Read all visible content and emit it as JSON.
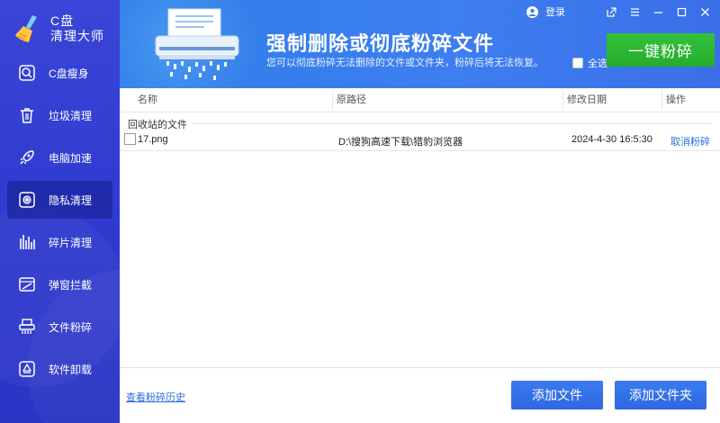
{
  "app": {
    "logo_line1": "C盘",
    "logo_line2": "清理大师"
  },
  "sidebar": {
    "items": [
      {
        "label": "C盘瘦身",
        "icon": "magnify-icon"
      },
      {
        "label": "垃圾清理",
        "icon": "trash-icon"
      },
      {
        "label": "电脑加速",
        "icon": "rocket-icon"
      },
      {
        "label": "隐私清理",
        "icon": "privacy-icon",
        "active": true
      },
      {
        "label": "碎片清理",
        "icon": "fragment-icon"
      },
      {
        "label": "弹窗拦截",
        "icon": "popup-block-icon"
      },
      {
        "label": "文件粉碎",
        "icon": "shredder-icon"
      },
      {
        "label": "软件卸载",
        "icon": "uninstall-icon"
      }
    ]
  },
  "header": {
    "title": "强制删除或彻底粉碎文件",
    "subtitle": "您可以彻底粉碎无法删除的文件或文件夹，粉碎后将无法恢复。",
    "login": "登录",
    "select_all": "全选",
    "shred_button": "一键粉碎"
  },
  "table": {
    "columns": [
      "名称",
      "原路径",
      "修改日期",
      "操作"
    ],
    "group_label": "回收站的文件",
    "rows": [
      {
        "name": "17.png",
        "path": "D:\\搜狗高速下载\\猎豹浏览器",
        "date": "2024-4-30 16:5:30",
        "action": "取消粉碎"
      }
    ]
  },
  "footer": {
    "history_link": "查看粉碎历史",
    "add_file": "添加文件",
    "add_folder": "添加文件夹"
  },
  "colors": {
    "sidebar": "#3a45d8",
    "header": "#3d7ef0",
    "accent_green": "#2db833",
    "button_blue": "#3373e8",
    "link": "#2b6ce0"
  }
}
